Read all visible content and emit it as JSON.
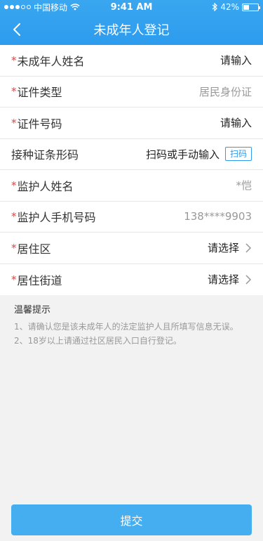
{
  "status_bar": {
    "carrier": "中国移动",
    "time": "9:41 AM",
    "battery": "42%",
    "battery_level": 0.42,
    "icons": [
      "signal-dots-icon",
      "wifi-icon",
      "bluetooth-icon",
      "battery-icon"
    ]
  },
  "nav": {
    "title": "未成年人登记",
    "back_icon": "chevron-left-icon"
  },
  "form": {
    "required_mark": "*",
    "rows": [
      {
        "label": "未成年人姓名",
        "value": "请输入",
        "required": true
      },
      {
        "label": "证件类型",
        "value": "居民身份证",
        "required": true
      },
      {
        "label": "证件号码",
        "value": "请输入",
        "required": true
      },
      {
        "label": "接种证条形码",
        "value": "扫码或手动输入",
        "button": "扫码",
        "required": false
      },
      {
        "label": "监护人姓名",
        "value": "*恺",
        "required": true
      },
      {
        "label": "监护人手机号码",
        "value": "138****9903",
        "required": true
      },
      {
        "label": "居住区",
        "value": "请选择",
        "required": true,
        "chevron": "chevron-right-icon"
      },
      {
        "label": "居住街道",
        "value": "请选择",
        "required": true,
        "chevron": "chevron-right-icon"
      }
    ]
  },
  "tips": {
    "title": "温馨提示",
    "items": [
      "1、请确认您是该未成年人的法定监护人且所填写信息无误。",
      "2、18岁以上请通过社区居民入口自行登记。"
    ]
  },
  "submit_label": "提交",
  "colors": {
    "primary": "#2d9cee",
    "submit": "#45aef0",
    "required": "#e64340",
    "background": "#f2f2f2"
  }
}
